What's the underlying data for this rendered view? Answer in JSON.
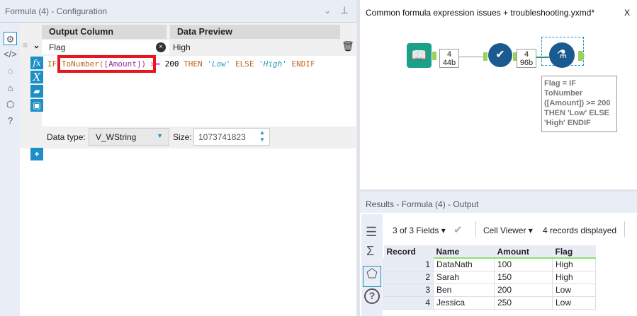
{
  "config": {
    "title": "Formula (4) - Configuration",
    "col_output": "Output Column",
    "col_preview": "Data Preview",
    "field_name": "Flag",
    "preview_value": "High",
    "expression": {
      "t1": "IF ",
      "t2": "ToNumber(",
      "t3": "[Amount]",
      "t4": ")",
      "t5": " >= ",
      "t6": "200",
      "t7": " THEN ",
      "t8": "'Low'",
      "t9": " ELSE ",
      "t10": "'High'",
      "t11": " ENDIF"
    },
    "data_type_label": "Data type:",
    "data_type": "V_WString",
    "size_label": "Size:",
    "size": "1073741823",
    "add_label": "+"
  },
  "workflow": {
    "title": "Common formula expression issues + troubleshooting.yxmd*",
    "close": "X",
    "conn1": {
      "records": "4",
      "bytes": "44b"
    },
    "conn2": {
      "records": "4",
      "bytes": "96b"
    },
    "annotation": "Flag = IF ToNumber ([Amount]) >= 200 THEN 'Low' ELSE 'High' ENDIF"
  },
  "results": {
    "title": "Results - Formula (4) - Output",
    "fields": "3 of 3 Fields",
    "viewer": "Cell Viewer",
    "records_displayed": "4 records displayed",
    "columns": [
      "Record",
      "Name",
      "Amount",
      "Flag"
    ],
    "rows": [
      [
        "1",
        "DataNath",
        "100",
        "High"
      ],
      [
        "2",
        "Sarah",
        "150",
        "High"
      ],
      [
        "3",
        "Ben",
        "200",
        "Low"
      ],
      [
        "4",
        "Jessica",
        "250",
        "Low"
      ]
    ]
  },
  "colors": {
    "accent": "#1e8fc6",
    "highlight": "#e8161e",
    "tool_blue": "#1b5a8e",
    "input_green": "#1aa187"
  }
}
